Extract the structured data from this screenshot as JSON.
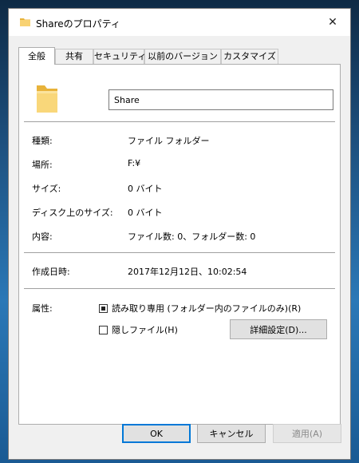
{
  "window": {
    "title": "Shareのプロパティ",
    "close_symbol": "✕"
  },
  "tabs": [
    {
      "label": "全般",
      "active": true
    },
    {
      "label": "共有",
      "active": false
    },
    {
      "label": "セキュリティ",
      "active": false
    },
    {
      "label": "以前のバージョン",
      "active": false
    },
    {
      "label": "カスタマイズ",
      "active": false
    }
  ],
  "general": {
    "name_value": "Share",
    "type_label": "種類:",
    "type_value": "ファイル フォルダー",
    "location_label": "場所:",
    "location_value": "F:¥",
    "size_label": "サイズ:",
    "size_value": "0 バイト",
    "disk_size_label": "ディスク上のサイズ:",
    "disk_size_value": "0 バイト",
    "contents_label": "内容:",
    "contents_value": "ファイル数: 0、フォルダー数: 0",
    "created_label": "作成日時:",
    "created_value": "2017年12月12日、10:02:54",
    "attributes_label": "属性:",
    "readonly_label": "読み取り専用 (フォルダー内のファイルのみ)(R)",
    "readonly_checked": true,
    "hidden_label": "隠しファイル(H)",
    "hidden_checked": false,
    "advanced_button": "詳細設定(D)..."
  },
  "buttons": {
    "ok": "OK",
    "cancel": "キャンセル",
    "apply": "適用(A)"
  },
  "colors": {
    "accent": "#0078d7",
    "folder": "#f6c54f"
  }
}
